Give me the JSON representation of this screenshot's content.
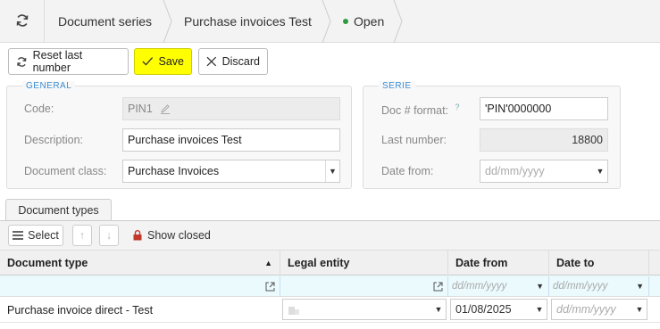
{
  "breadcrumb": {
    "items": [
      "Document series",
      "Purchase invoices Test"
    ],
    "status": "Open",
    "status_color": "#2e9a3e"
  },
  "toolbar": {
    "reset_label": "Reset last number",
    "save_label": "Save",
    "discard_label": "Discard"
  },
  "general": {
    "legend": "GENERAL",
    "code_label": "Code:",
    "code_value": "PIN1",
    "description_label": "Description:",
    "description_value": "Purchase invoices Test",
    "doc_class_label": "Document class:",
    "doc_class_value": "Purchase Invoices"
  },
  "serie": {
    "legend": "SERIE",
    "format_label": "Doc # format:",
    "format_help": "?",
    "format_value": "'PIN'0000000",
    "last_number_label": "Last number:",
    "last_number_value": "18800",
    "date_from_label": "Date from:",
    "date_from_placeholder": "dd/mm/yyyy"
  },
  "tabs": [
    "Document types"
  ],
  "subtoolbar": {
    "select_label": "Select",
    "show_closed_label": "Show closed"
  },
  "grid": {
    "columns": [
      "Document type",
      "Legal entity",
      "Date from",
      "Date to"
    ],
    "filter_placeholder": "dd/mm/yyyy",
    "rows": [
      {
        "document_type": "Purchase invoice direct - Test",
        "legal_entity": "",
        "date_from": "01/08/2025",
        "date_to_placeholder": "dd/mm/yyyy"
      }
    ]
  }
}
